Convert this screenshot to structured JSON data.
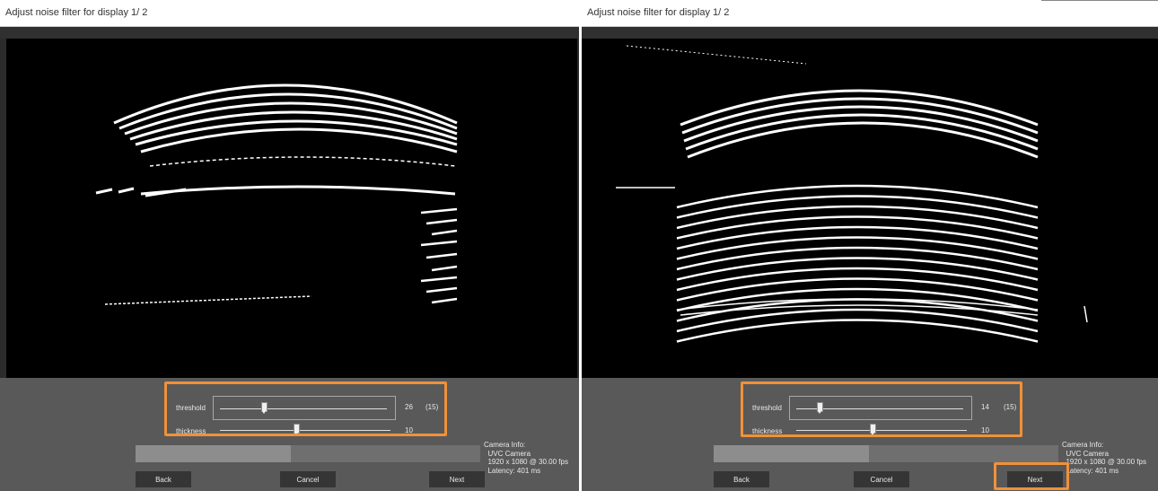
{
  "panels": [
    {
      "window_title": "Adjust noise filter  for display 1/ 2",
      "threshold": {
        "label": "threshold",
        "value": "26",
        "extra": "(15)"
      },
      "thickness": {
        "label": "thickness",
        "value": "10"
      },
      "camera_info": {
        "heading": "Camera Info:",
        "line1": "UVC Camera",
        "line2": "1920 x 1080 @ 30.00 fps",
        "line3": "Latency: 401 ms"
      },
      "buttons": {
        "back": "Back",
        "cancel": "Cancel",
        "next": "Next"
      }
    },
    {
      "window_title": "Adjust noise filter  for display 1/ 2",
      "threshold": {
        "label": "threshold",
        "value": "14",
        "extra": "(15)"
      },
      "thickness": {
        "label": "thickness",
        "value": "10"
      },
      "camera_info": {
        "heading": "Camera Info:",
        "line1": "UVC Camera",
        "line2": "1920 x 1080 @ 30.00 fps",
        "line3": "Latency: 401 ms"
      },
      "buttons": {
        "back": "Back",
        "cancel": "Cancel",
        "next": "Next"
      }
    }
  ],
  "colors": {
    "highlight": "#f0913a",
    "panel_bg": "#595959",
    "camera_bg": "#000000",
    "stripe": "#ffffff"
  }
}
